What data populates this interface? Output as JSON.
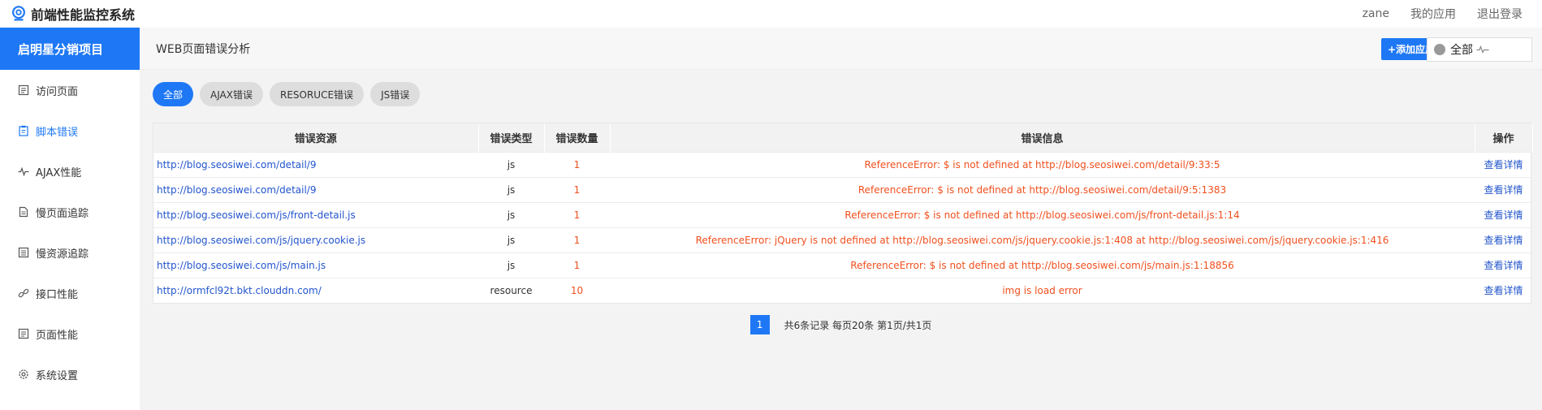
{
  "header": {
    "app_title": "前端性能监控系统",
    "user": "zane",
    "my_apps": "我的应用",
    "logout": "退出登录"
  },
  "sidebar": {
    "project": "启明星分销项目",
    "items": [
      {
        "label": "访问页面",
        "icon": "document-icon",
        "active": false
      },
      {
        "label": "脚本错误",
        "icon": "clipboard-icon",
        "active": true
      },
      {
        "label": "AJAX性能",
        "icon": "pulse-icon",
        "active": false
      },
      {
        "label": "慢页面追踪",
        "icon": "page-icon",
        "active": false
      },
      {
        "label": "慢资源追踪",
        "icon": "list-icon",
        "active": false
      },
      {
        "label": "接口性能",
        "icon": "link-icon",
        "active": false
      },
      {
        "label": "页面性能",
        "icon": "document-icon",
        "active": false
      },
      {
        "label": "系统设置",
        "icon": "gear-icon",
        "active": false
      }
    ]
  },
  "page": {
    "title": "WEB页面错误分析",
    "add_app": "+添加应用",
    "app_select": "全部"
  },
  "filters": [
    "全部",
    "AJAX错误",
    "RESORUCE错误",
    "JS错误"
  ],
  "table": {
    "columns": [
      "错误资源",
      "错误类型",
      "错误数量",
      "错误信息",
      "操作"
    ],
    "rows": [
      {
        "resource": "http://blog.seosiwei.com/detail/9",
        "type": "js",
        "count": "1",
        "message": "ReferenceError: $ is not defined at http://blog.seosiwei.com/detail/9:33:5",
        "action": "查看详情"
      },
      {
        "resource": "http://blog.seosiwei.com/detail/9",
        "type": "js",
        "count": "1",
        "message": "ReferenceError: $ is not defined at http://blog.seosiwei.com/detail/9:5:1383",
        "action": "查看详情"
      },
      {
        "resource": "http://blog.seosiwei.com/js/front-detail.js",
        "type": "js",
        "count": "1",
        "message": "ReferenceError: $ is not defined at http://blog.seosiwei.com/js/front-detail.js:1:14",
        "action": "查看详情"
      },
      {
        "resource": "http://blog.seosiwei.com/js/jquery.cookie.js",
        "type": "js",
        "count": "1",
        "message": "ReferenceError: jQuery is not defined at http://blog.seosiwei.com/js/jquery.cookie.js:1:408 at http://blog.seosiwei.com/js/jquery.cookie.js:1:416",
        "action": "查看详情"
      },
      {
        "resource": "http://blog.seosiwei.com/js/main.js",
        "type": "js",
        "count": "1",
        "message": "ReferenceError: $ is not defined at http://blog.seosiwei.com/js/main.js:1:18856",
        "action": "查看详情"
      },
      {
        "resource": "http://ormfcl92t.bkt.clouddn.com/",
        "type": "resource",
        "count": "10",
        "message": "img is load error",
        "action": "查看详情"
      }
    ]
  },
  "pager": {
    "current": "1",
    "info": "共6条记录  每页20条  第1页/共1页"
  },
  "colors": {
    "accent": "#1e78f5",
    "error": "#f0501e",
    "link": "#2255cc"
  }
}
